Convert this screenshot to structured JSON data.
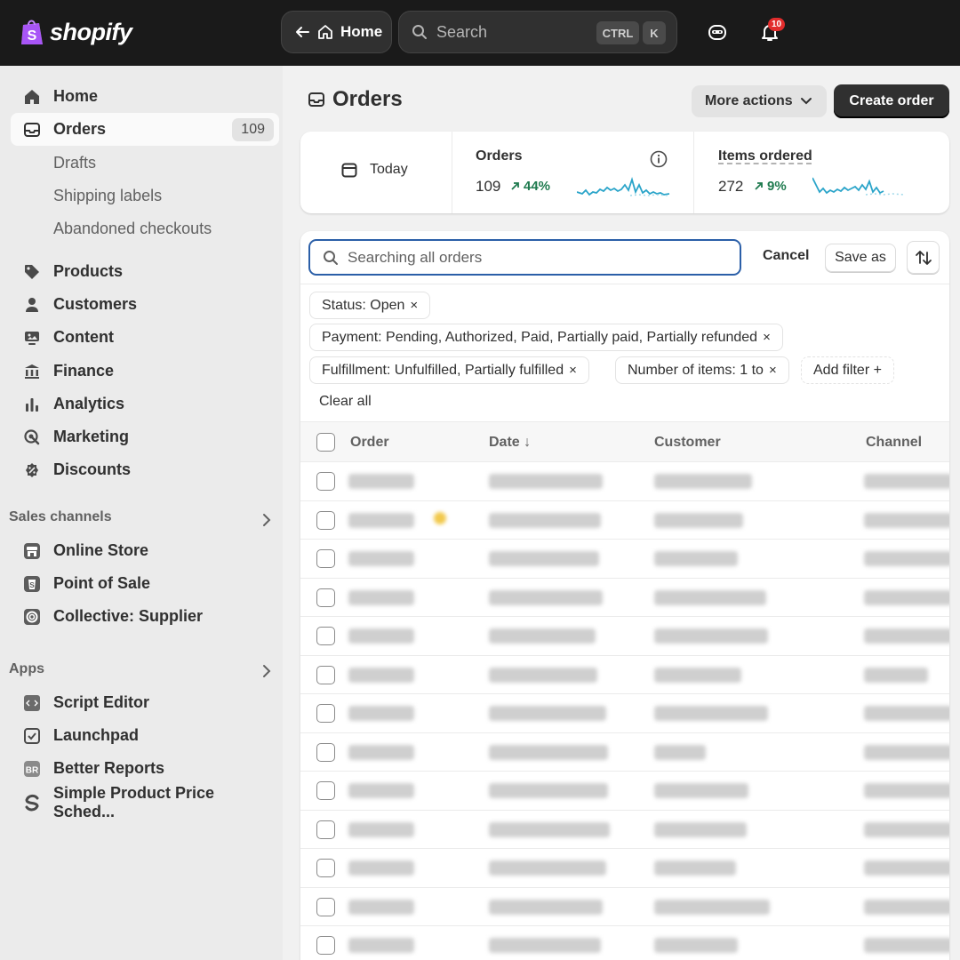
{
  "app": {
    "brand": "shopify"
  },
  "topbar": {
    "home_label": "Home",
    "search_placeholder": "Search",
    "shortcut_ctrl": "CTRL",
    "shortcut_k": "K",
    "notification_count": "10"
  },
  "sidebar": {
    "home": "Home",
    "orders": "Orders",
    "orders_count": "109",
    "drafts": "Drafts",
    "shipping_labels": "Shipping labels",
    "abandoned_checkouts": "Abandoned checkouts",
    "products": "Products",
    "customers": "Customers",
    "content": "Content",
    "finance": "Finance",
    "analytics": "Analytics",
    "marketing": "Marketing",
    "discounts": "Discounts",
    "sales_channels_title": "Sales channels",
    "online_store": "Online Store",
    "point_of_sale": "Point of Sale",
    "collective": "Collective: Supplier",
    "apps_title": "Apps",
    "script_editor": "Script Editor",
    "launchpad": "Launchpad",
    "better_reports": "Better Reports",
    "simple_price": "Simple Product Price Sched..."
  },
  "page": {
    "title": "Orders",
    "more_actions": "More actions",
    "create_order": "Create order"
  },
  "metrics": {
    "period": "Today",
    "orders_label": "Orders",
    "orders_value": "109",
    "orders_change": "44%",
    "items_label": "Items ordered",
    "items_value": "272",
    "items_change": "9%"
  },
  "filters": {
    "search_placeholder": "Searching all orders",
    "cancel": "Cancel",
    "save_as": "Save as",
    "chip_status": "Status: Open",
    "chip_payment": "Payment: Pending, Authorized, Paid, Partially paid, Partially refunded",
    "chip_fulfillment": "Fulfillment: Unfulfilled, Partially fulfilled",
    "chip_items": "Number of items: 1 to",
    "add_filter": "Add filter +",
    "clear_all": "Clear all"
  },
  "table": {
    "col_order": "Order",
    "col_date": "Date ↓",
    "col_customer": "Customer",
    "col_channel": "Channel"
  },
  "colors": {
    "topbar": "#1a1a1a",
    "accent_focus": "#2b5fa8",
    "positive": "#1e7a4e",
    "sparkline": "#2aa4c9"
  }
}
